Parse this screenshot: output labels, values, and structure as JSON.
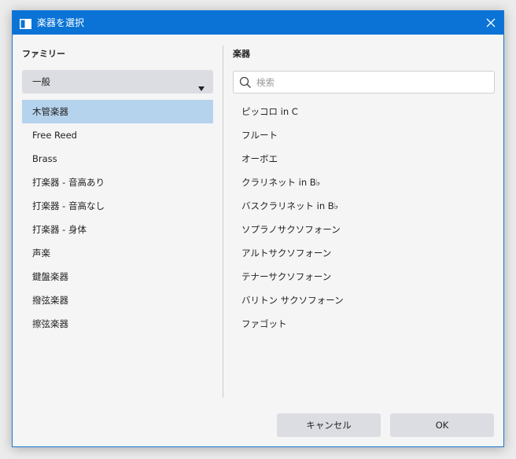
{
  "window": {
    "title": "楽器を選択",
    "accent_color": "#0a73d5",
    "selection_color": "#b6d3ee"
  },
  "icons": {
    "app": "window-icon",
    "close": "close-icon",
    "dropdown": "caret-down-icon",
    "search": "search-icon"
  },
  "family_panel": {
    "label": "ファミリー",
    "dropdown_value": "一般",
    "selected_index": 0,
    "items": [
      "木管楽器",
      "Free Reed",
      "Brass",
      "打楽器 - 音高あり",
      "打楽器 - 音高なし",
      "打楽器 - 身体",
      "声楽",
      "鍵盤楽器",
      "撥弦楽器",
      "擦弦楽器"
    ]
  },
  "instrument_panel": {
    "label": "楽器",
    "search_placeholder": "検索",
    "search_value": "",
    "items": [
      "ピッコロ in C",
      "フルート",
      "オーボエ",
      "クラリネット in B♭",
      "バスクラリネット in B♭",
      "ソプラノサクソフォーン",
      "アルトサクソフォーン",
      "テナーサクソフォーン",
      "バリトン サクソフォーン",
      "ファゴット"
    ]
  },
  "buttons": {
    "cancel": "キャンセル",
    "ok": "OK"
  }
}
